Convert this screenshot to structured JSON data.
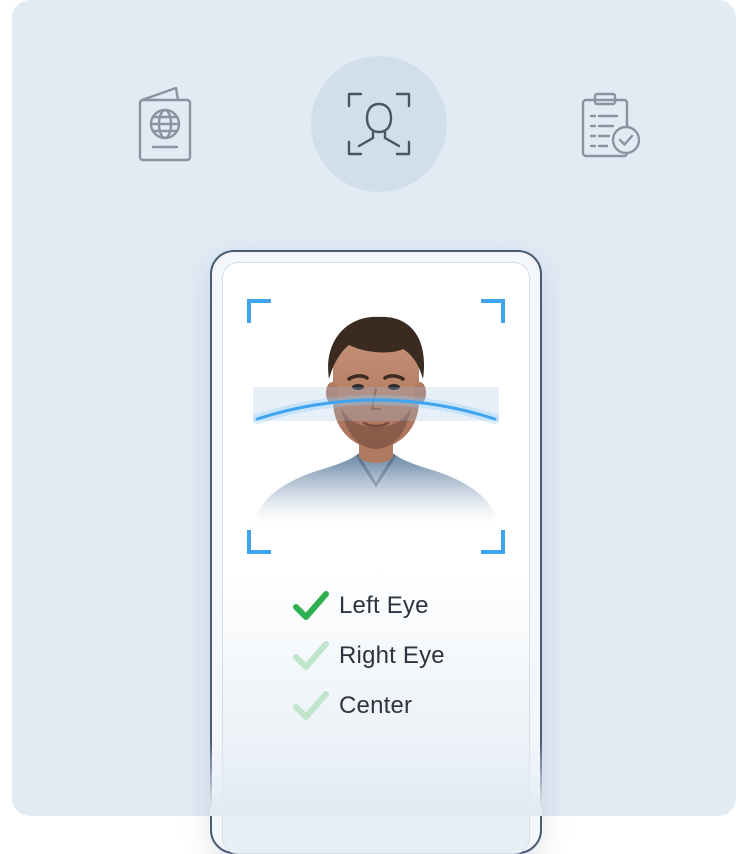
{
  "steps": [
    {
      "icon": "passport-icon",
      "state": "inactive"
    },
    {
      "icon": "face-scan-icon",
      "state": "active"
    },
    {
      "icon": "checklist-icon",
      "state": "inactive"
    }
  ],
  "checks": [
    {
      "label": "Left Eye",
      "status": "complete"
    },
    {
      "label": "Right Eye",
      "status": "pending"
    },
    {
      "label": "Center",
      "status": "pending"
    }
  ],
  "colors": {
    "background": "#e2ebf4",
    "accent_blue": "#3fa3ef",
    "check_green": "#2fb050",
    "check_green_faded": "#bfe6cc",
    "icon_gray": "#8a94a0"
  }
}
